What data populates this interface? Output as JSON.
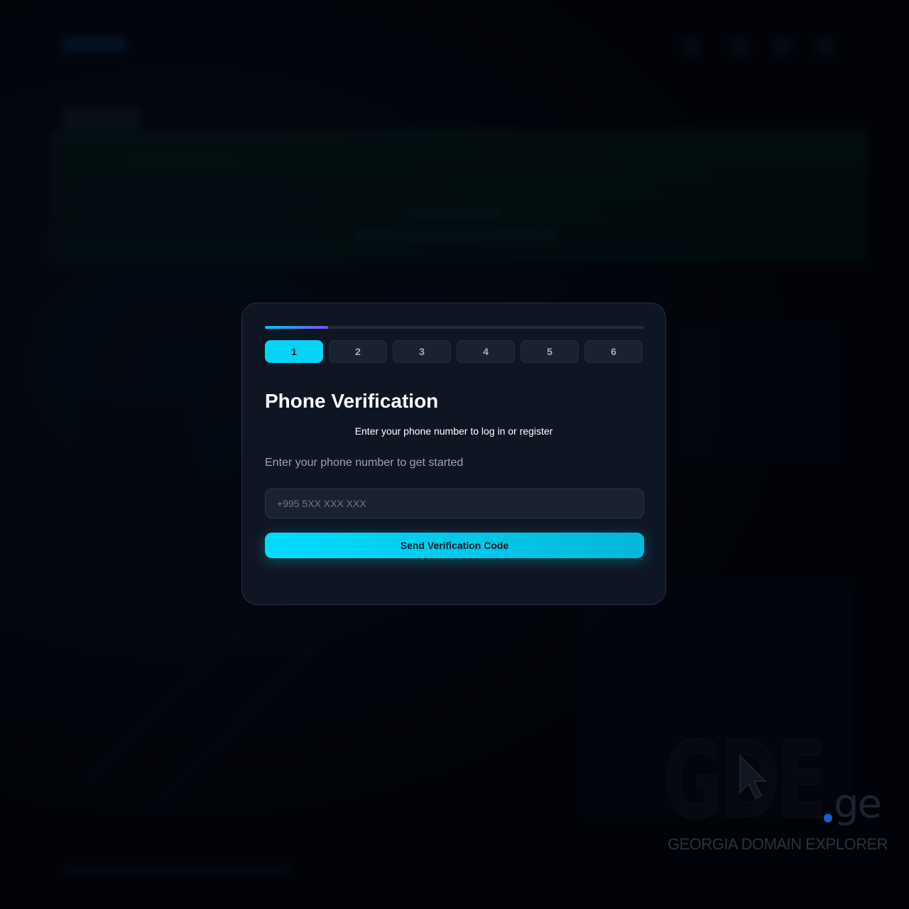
{
  "stepper": {
    "progress": 0.1667,
    "current_step": 1,
    "steps": [
      "1",
      "2",
      "3",
      "4",
      "5",
      "6"
    ]
  },
  "modal": {
    "title": "Phone Verification",
    "subtitle": "Enter your phone number to log in or register",
    "hint": "Enter your phone number to get started",
    "phone_input": {
      "value": "",
      "placeholder": "+995 5XX XXX XXX"
    },
    "send_button_label": "Send Verification Code"
  },
  "watermark": {
    "letters": "GDE",
    "tld": "ge",
    "tagline": "GEORGIA DOMAIN EXPLORER"
  },
  "colors": {
    "accent": "#05d4f8",
    "progress_end": "#7a4ff0",
    "modal_bg": "#0f1623",
    "page_bg": "#03060d",
    "brand_dot": "#1a5ad6"
  }
}
